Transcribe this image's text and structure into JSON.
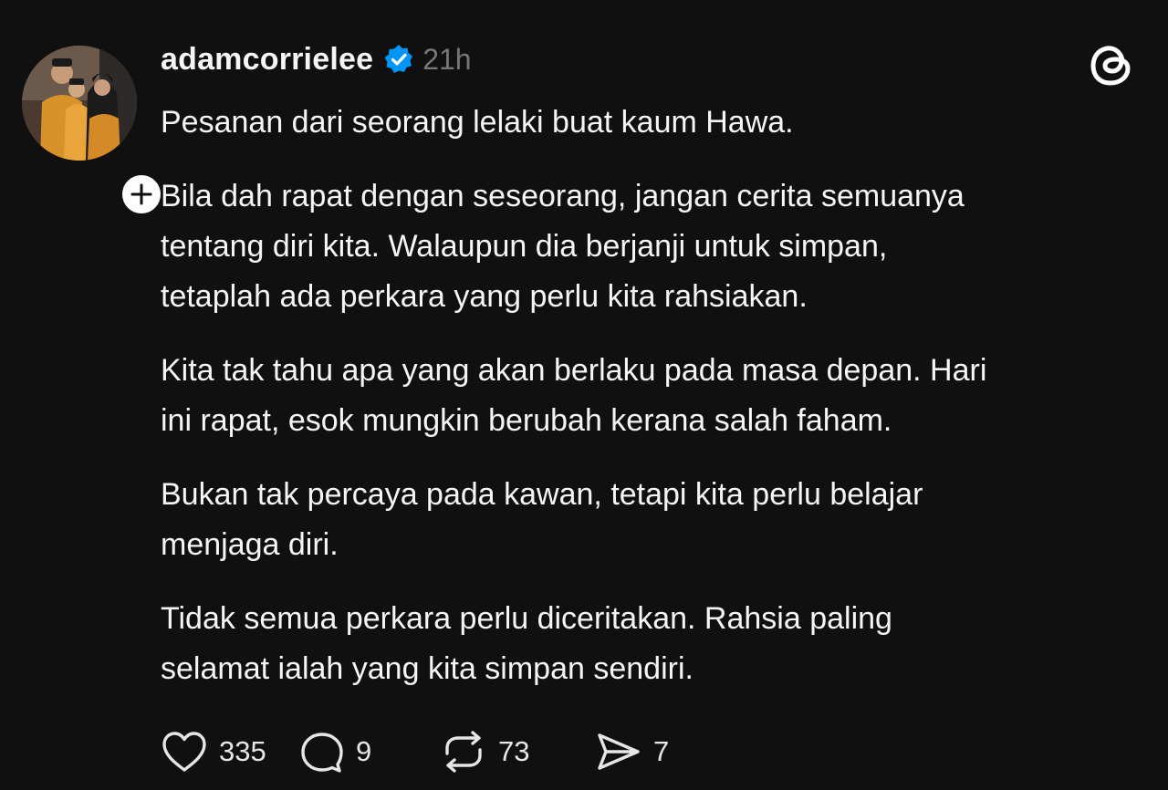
{
  "post": {
    "author": {
      "username": "adamcorrielee",
      "verified": true,
      "avatar_icon": "family-photo-avatar",
      "follow_icon": "plus-icon"
    },
    "timestamp": "21h",
    "app_logo": "threads-logo-icon",
    "paragraphs": [
      "Pesanan dari seorang lelaki buat kaum Hawa.",
      "Bila dah rapat dengan seseorang, jangan cerita semuanya\ntentang diri kita. Walaupun dia berjanji untuk simpan,\ntetaplah ada perkara yang perlu kita rahsiakan.",
      "Kita tak tahu apa yang akan berlaku pada masa depan. Hari\nini rapat, esok mungkin berubah kerana salah faham.",
      "Bukan tak percaya pada kawan, tetapi kita perlu belajar\nmenjaga diri.",
      "Tidak semua perkara perlu diceritakan. Rahsia paling\nselamat ialah yang kita simpan sendiri."
    ],
    "actions": {
      "likes": "335",
      "replies": "9",
      "reposts": "73",
      "shares": "7"
    }
  },
  "colors": {
    "background": "#101010",
    "text": "#f3f5f7",
    "muted": "#777777",
    "verified": "#0095f6"
  }
}
